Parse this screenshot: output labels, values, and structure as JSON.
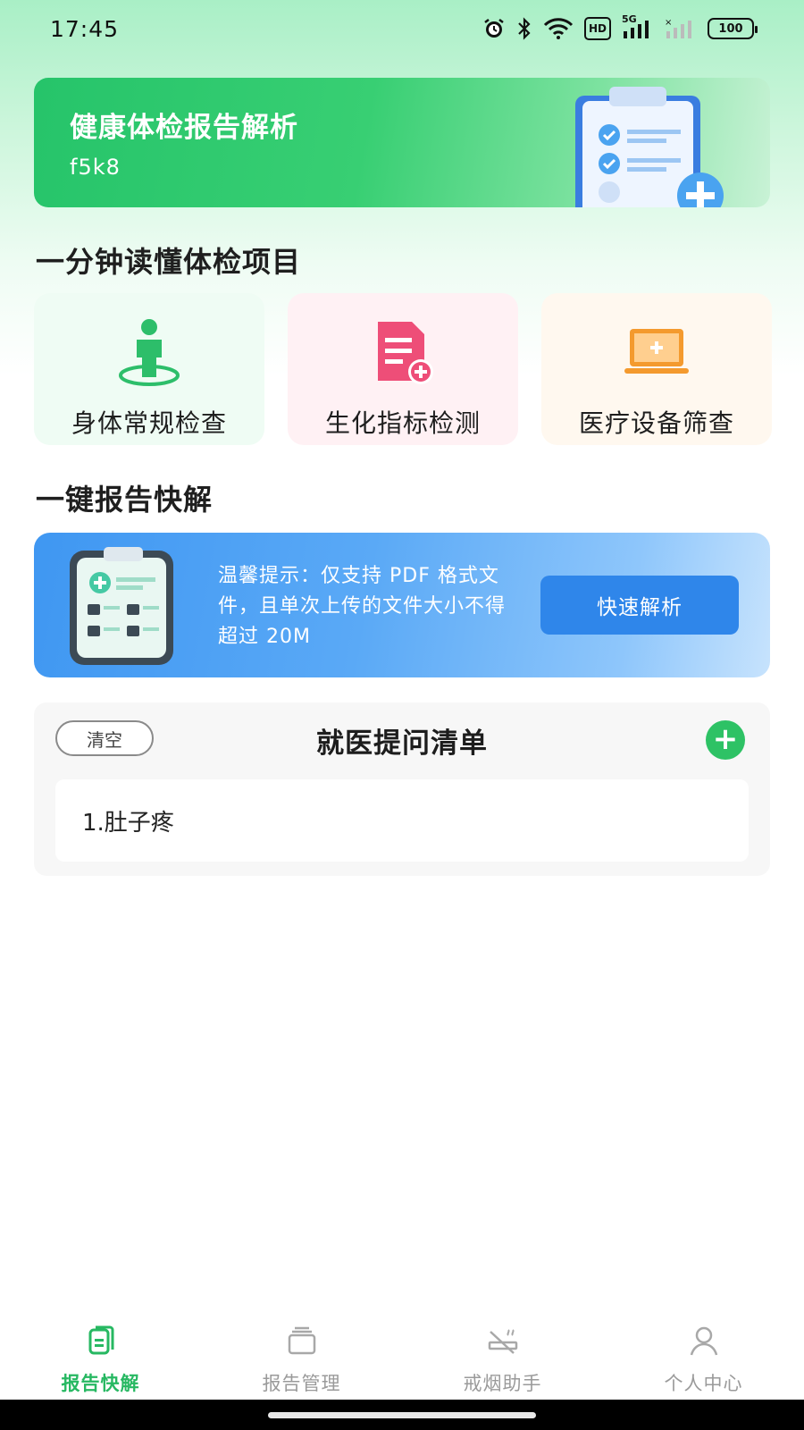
{
  "status_bar": {
    "time": "17:45",
    "icons": [
      "alarm-icon",
      "bluetooth-icon",
      "wifi-icon",
      "hd-icon",
      "signal-5g-icon",
      "signal-icon"
    ],
    "hd_text": "HD",
    "network": "5G",
    "battery": "100"
  },
  "hero": {
    "title": "健康体检报告解析",
    "subtitle": "f5k8"
  },
  "section_exam": {
    "title": "一分钟读懂体检项目"
  },
  "categories": [
    {
      "label": "身体常规检查",
      "icon": "person-icon",
      "color": "#2dbe6a"
    },
    {
      "label": "生化指标检测",
      "icon": "document-plus-icon",
      "color": "#ee4e78"
    },
    {
      "label": "医疗设备筛查",
      "icon": "laptop-plus-icon",
      "color": "#f49a2e"
    }
  ],
  "section_report": {
    "title": "一键报告快解"
  },
  "upload": {
    "tip": "温馨提示：仅支持 PDF 格式文件，且单次上传的文件大小不得超过 20M",
    "button": "快速解析"
  },
  "question_list": {
    "clear_label": "清空",
    "title": "就医提问清单",
    "add_symbol": "+",
    "items": [
      "1.肚子疼"
    ]
  },
  "bottom_nav": [
    {
      "label": "报告快解",
      "icon": "report-icon",
      "active": true
    },
    {
      "label": "报告管理",
      "icon": "folder-icon",
      "active": false
    },
    {
      "label": "戒烟助手",
      "icon": "no-smoking-icon",
      "active": false
    },
    {
      "label": "个人中心",
      "icon": "user-icon",
      "active": false
    }
  ],
  "colors": {
    "accent_green": "#27b862",
    "accent_blue": "#2f86ea"
  }
}
